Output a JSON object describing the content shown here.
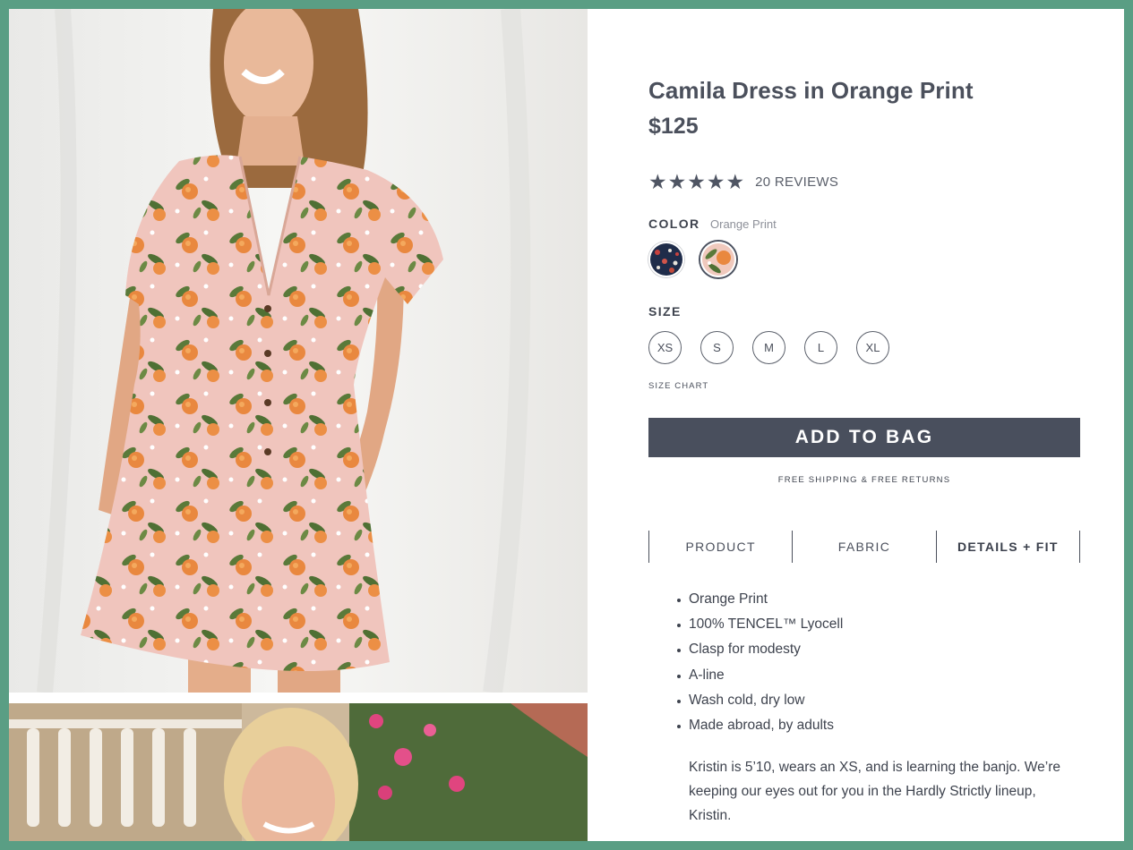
{
  "product": {
    "title": "Camila Dress in Orange Print",
    "price": "$125",
    "rating": 5,
    "reviews_label": "20 REVIEWS"
  },
  "color": {
    "label": "COLOR",
    "selected": "Orange Print",
    "swatches": [
      "navy-floral",
      "orange-print"
    ]
  },
  "size": {
    "label": "SIZE",
    "options": [
      "XS",
      "S",
      "M",
      "L",
      "XL"
    ],
    "chart_link": "SIZE CHART"
  },
  "cta": {
    "add_to_bag": "ADD TO BAG",
    "shipping_note": "FREE SHIPPING & FREE RETURNS"
  },
  "tabs": [
    {
      "label": "PRODUCT",
      "active": false
    },
    {
      "label": "FABRIC",
      "active": false
    },
    {
      "label": "DETAILS + FIT",
      "active": true
    }
  ],
  "details": [
    "Orange Print",
    "100% TENCEL™ Lyocell",
    "Clasp for modesty",
    "A-line",
    "Wash cold, dry low",
    "Made abroad, by adults"
  ],
  "fit_note": "Kristin is 5’10, wears an XS, and is learning the banjo. We’re keeping our eyes out for you in the Hardly Strictly lineup, Kristin.",
  "colors": {
    "page_border": "#5a9e84",
    "button": "#494f5d",
    "text": "#4b505c"
  }
}
